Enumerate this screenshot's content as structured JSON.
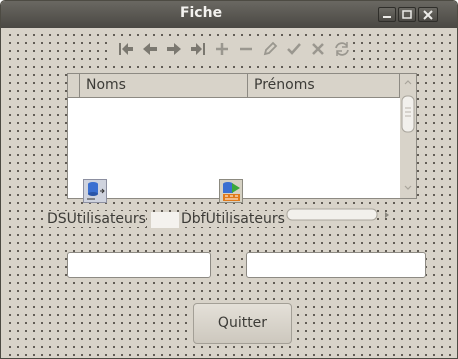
{
  "window": {
    "title": "Fiche",
    "controls": [
      "minimize-icon",
      "maximize-icon",
      "close-icon"
    ]
  },
  "navigator": {
    "buttons": [
      {
        "name": "first",
        "icon": "first-record-icon"
      },
      {
        "name": "prior",
        "icon": "prior-record-icon"
      },
      {
        "name": "next",
        "icon": "next-record-icon"
      },
      {
        "name": "last",
        "icon": "last-record-icon"
      },
      {
        "name": "insert",
        "icon": "plus-icon"
      },
      {
        "name": "delete",
        "icon": "minus-icon"
      },
      {
        "name": "edit",
        "icon": "pencil-icon"
      },
      {
        "name": "post",
        "icon": "checkmark-icon"
      },
      {
        "name": "cancel",
        "icon": "cross-icon"
      },
      {
        "name": "refresh",
        "icon": "refresh-icon"
      }
    ]
  },
  "grid": {
    "columns": [
      "Noms",
      "Prénoms"
    ],
    "rows": []
  },
  "components": {
    "datasource_label": "DSUtilisateurs",
    "dbf_label": "DbfUtilisateurs"
  },
  "fields": {
    "nom_value": "",
    "prenom_value": ""
  },
  "buttons": {
    "quit_label": "Quitter"
  },
  "colors": {
    "titlebar": "#4f4d48",
    "form_background": "#d8d3c9",
    "nav_icon_green": "#6a8b3a",
    "nav_icon_gray": "#7b7870"
  }
}
